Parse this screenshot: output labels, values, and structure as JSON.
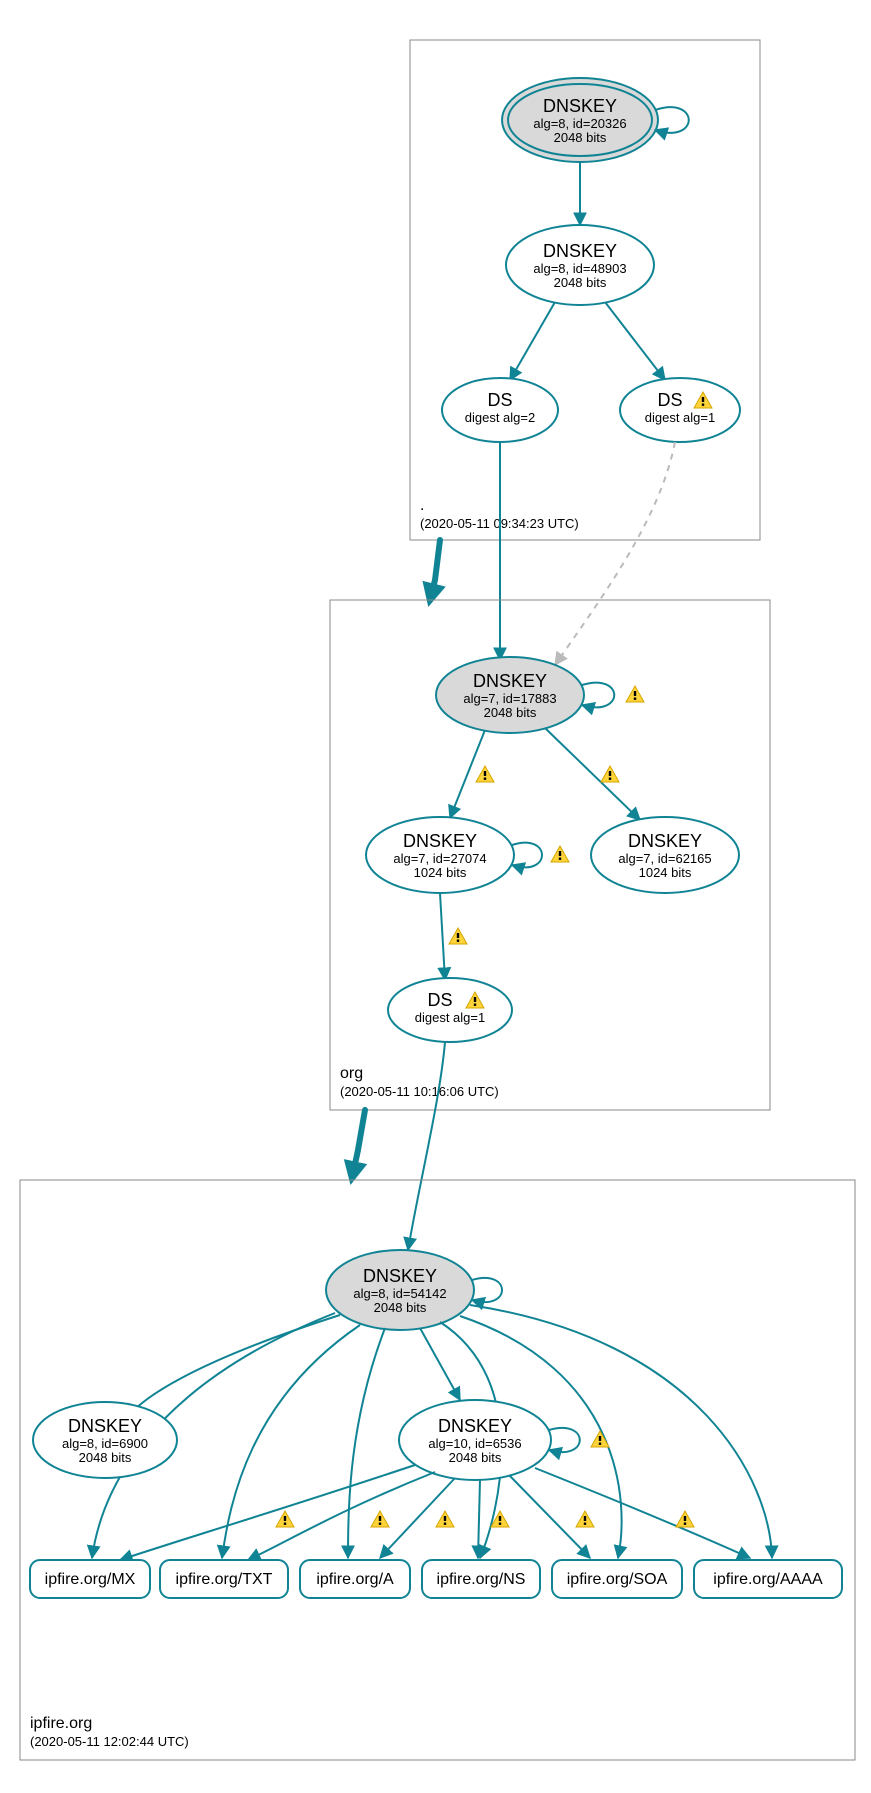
{
  "diagram": {
    "type": "dnssec-authentication-chain",
    "zones": [
      {
        "id": "root",
        "name": ".",
        "timestamp": "(2020-05-11 09:34:23 UTC)",
        "nodes": [
          {
            "id": "root-ksk",
            "type": "DNSKEY-KSK",
            "title": "DNSKEY",
            "line2": "alg=8, id=20326",
            "line3": "2048 bits",
            "self_loop": true,
            "warning_on_loop": false
          },
          {
            "id": "root-zsk",
            "type": "DNSKEY",
            "title": "DNSKEY",
            "line2": "alg=8, id=48903",
            "line3": "2048 bits"
          },
          {
            "id": "root-ds2",
            "type": "DS",
            "title": "DS",
            "line2": "digest alg=2",
            "warning_inline": false
          },
          {
            "id": "root-ds1",
            "type": "DS",
            "title": "DS",
            "line2": "digest alg=1",
            "warning_inline": true
          }
        ],
        "edges": [
          {
            "from": "root-ksk",
            "to": "root-zsk"
          },
          {
            "from": "root-zsk",
            "to": "root-ds2"
          },
          {
            "from": "root-zsk",
            "to": "root-ds1"
          }
        ]
      },
      {
        "id": "org",
        "name": "org",
        "timestamp": "(2020-05-11 10:16:06 UTC)",
        "nodes": [
          {
            "id": "org-ksk",
            "type": "DNSKEY-KSK",
            "title": "DNSKEY",
            "line2": "alg=7, id=17883",
            "line3": "2048 bits",
            "self_loop": true,
            "warning_on_loop": true
          },
          {
            "id": "org-zsk1",
            "type": "DNSKEY",
            "title": "DNSKEY",
            "line2": "alg=7, id=27074",
            "line3": "1024 bits",
            "self_loop": true,
            "warning_on_loop": true
          },
          {
            "id": "org-zsk2",
            "type": "DNSKEY",
            "title": "DNSKEY",
            "line2": "alg=7, id=62165",
            "line3": "1024 bits"
          },
          {
            "id": "org-ds",
            "type": "DS",
            "title": "DS",
            "line2": "digest alg=1",
            "warning_inline": true
          }
        ],
        "edges": [
          {
            "from": "org-ksk",
            "to": "org-zsk1",
            "warning": true
          },
          {
            "from": "org-ksk",
            "to": "org-zsk2",
            "warning": true
          },
          {
            "from": "org-zsk1",
            "to": "org-ds",
            "warning": true
          }
        ]
      },
      {
        "id": "ipfire",
        "name": "ipfire.org",
        "timestamp": "(2020-05-11 12:02:44 UTC)",
        "nodes": [
          {
            "id": "ip-ksk",
            "type": "DNSKEY-KSK",
            "title": "DNSKEY",
            "line2": "alg=8, id=54142",
            "line3": "2048 bits",
            "self_loop": true,
            "warning_on_loop": false
          },
          {
            "id": "ip-k6900",
            "type": "DNSKEY",
            "title": "DNSKEY",
            "line2": "alg=8, id=6900",
            "line3": "2048 bits"
          },
          {
            "id": "ip-k6536",
            "type": "DNSKEY",
            "title": "DNSKEY",
            "line2": "alg=10, id=6536",
            "line3": "2048 bits",
            "self_loop": true,
            "warning_on_loop": true
          },
          {
            "id": "rr-mx",
            "type": "RR",
            "label": "ipfire.org/MX"
          },
          {
            "id": "rr-txt",
            "type": "RR",
            "label": "ipfire.org/TXT"
          },
          {
            "id": "rr-a",
            "type": "RR",
            "label": "ipfire.org/A"
          },
          {
            "id": "rr-ns",
            "type": "RR",
            "label": "ipfire.org/NS"
          },
          {
            "id": "rr-soa",
            "type": "RR",
            "label": "ipfire.org/SOA"
          },
          {
            "id": "rr-aaaa",
            "type": "RR",
            "label": "ipfire.org/AAAA"
          }
        ],
        "edges": [
          {
            "from": "ip-ksk",
            "to": "ip-k6900"
          },
          {
            "from": "ip-ksk",
            "to": "ip-k6536"
          },
          {
            "from": "ip-ksk",
            "to": "rr-mx"
          },
          {
            "from": "ip-ksk",
            "to": "rr-txt"
          },
          {
            "from": "ip-ksk",
            "to": "rr-a"
          },
          {
            "from": "ip-ksk",
            "to": "rr-ns"
          },
          {
            "from": "ip-ksk",
            "to": "rr-soa"
          },
          {
            "from": "ip-ksk",
            "to": "rr-aaaa"
          },
          {
            "from": "ip-k6536",
            "to": "rr-mx"
          },
          {
            "from": "ip-k6536",
            "to": "rr-txt",
            "warning": true
          },
          {
            "from": "ip-k6536",
            "to": "rr-a",
            "warning": true
          },
          {
            "from": "ip-k6536",
            "to": "rr-ns",
            "warning": true
          },
          {
            "from": "ip-k6536",
            "to": "rr-soa",
            "warning": true
          },
          {
            "from": "ip-k6536",
            "to": "rr-aaaa",
            "warning": true
          }
        ]
      }
    ],
    "delegations": [
      {
        "from_zone": "root",
        "ds_node": "root-ds2",
        "to_key": "org-ksk",
        "style": "solid"
      },
      {
        "from_zone": "root",
        "ds_node": "root-ds1",
        "to_key": "org-ksk",
        "style": "dashed"
      },
      {
        "from_zone": "org",
        "ds_node": "org-ds",
        "to_key": "ip-ksk",
        "style": "solid"
      }
    ],
    "colors": {
      "stroke": "#108494",
      "ksk_fill": "#d9d9d9",
      "zone_border": "#888888"
    }
  }
}
